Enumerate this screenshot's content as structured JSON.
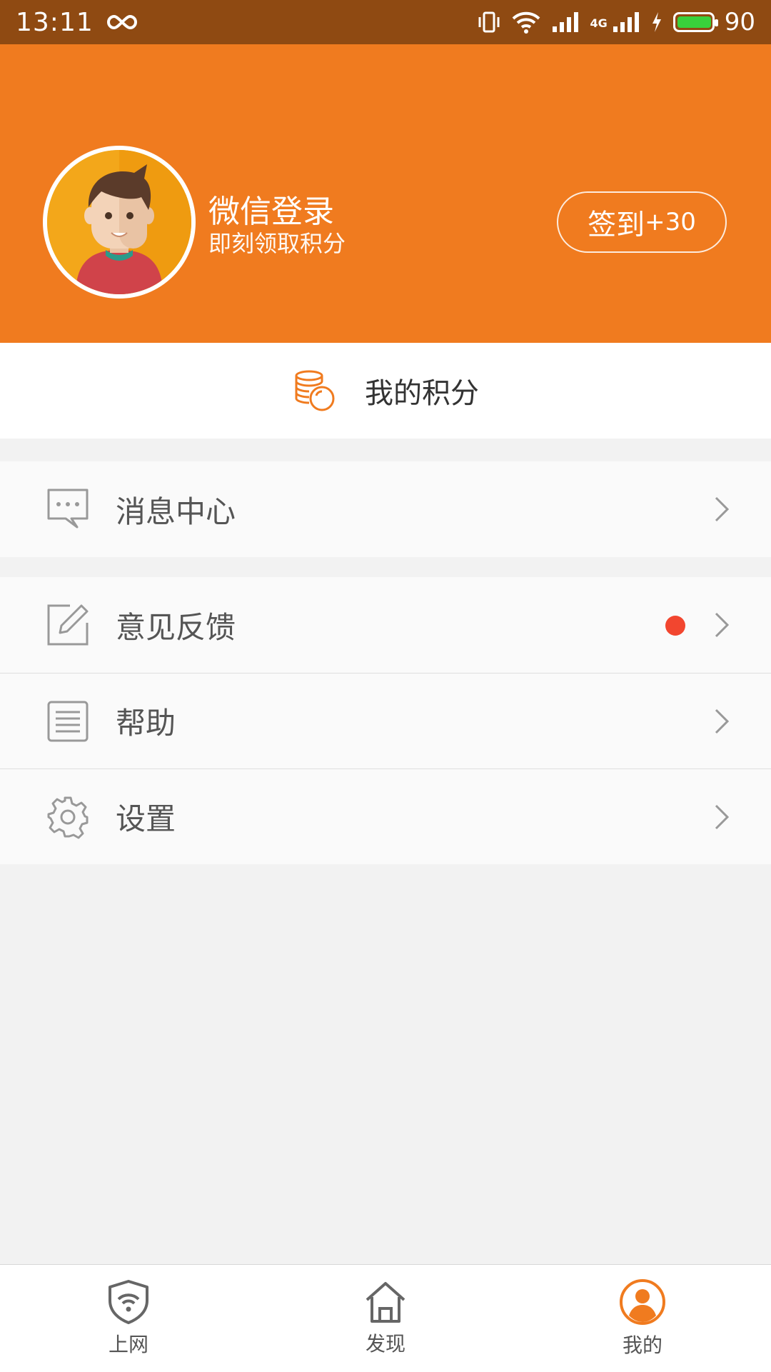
{
  "status": {
    "time": "13:11",
    "battery": "90",
    "network": "4G"
  },
  "header": {
    "title": "微信登录",
    "subtitle": "即刻领取积分",
    "checkin_label": "签到",
    "checkin_bonus": "+30"
  },
  "points": {
    "label": "我的积分"
  },
  "menu": {
    "messages": "消息中心",
    "feedback": "意见反馈",
    "help": "帮助",
    "settings": "设置"
  },
  "tabs": [
    {
      "label": "上网",
      "icon": "shield-wifi-icon"
    },
    {
      "label": "发现",
      "icon": "home-icon"
    },
    {
      "label": "我的",
      "icon": "profile-icon"
    }
  ],
  "colors": {
    "accent": "#f07b1f",
    "status_bar": "#8f4a12",
    "badge": "#f2462f"
  }
}
